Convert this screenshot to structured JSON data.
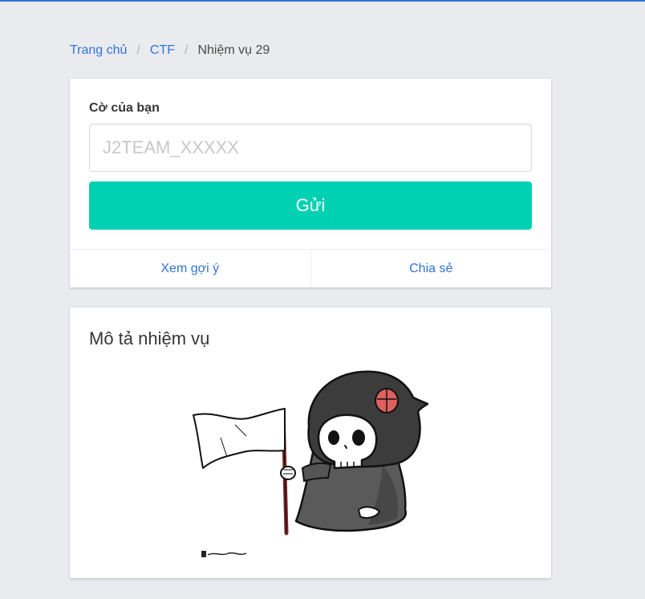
{
  "accent_color": "#3273dc",
  "breadcrumb": {
    "items": [
      {
        "label": "Trang chủ",
        "link": true
      },
      {
        "label": "CTF",
        "link": true
      },
      {
        "label": "Nhiệm vụ 29",
        "link": false
      }
    ],
    "separator": "/"
  },
  "flag_form": {
    "label": "Cờ của bạn",
    "input_value": "",
    "input_placeholder": "J2TEAM_XXXXX",
    "submit_label": "Gửi",
    "submit_color": "#00d1b2",
    "footer_links": [
      "Xem gợi ý",
      "Chia sẻ"
    ]
  },
  "description": {
    "title": "Mô tả nhiệm vụ",
    "image": "grim-reaper-holding-white-flag"
  }
}
